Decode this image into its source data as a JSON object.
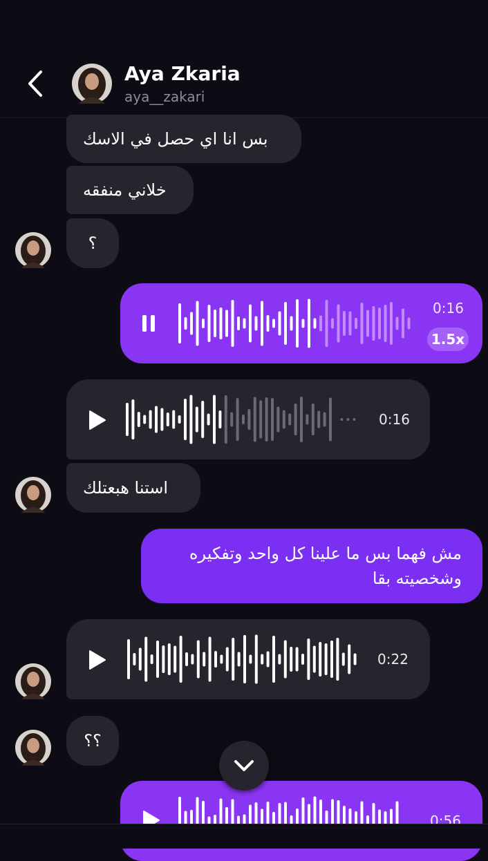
{
  "header": {
    "title": "Aya Zkaria",
    "username": "aya__zakari"
  },
  "messages": {
    "m1": "بس انا اي حصل في الاسك",
    "m2": "خلاني منفقه",
    "m3": "؟",
    "m4_duration": "0:16",
    "m4_speed": "1.5x",
    "m5_duration": "0:16",
    "m6": "استنا هبعتلك",
    "m7_line1": "مش فهما بس ما علينا كل واحد وتفكيره",
    "m7_line2": "وشخصيته بقا",
    "m8_duration": "0:22",
    "m9": "؟؟",
    "m10_duration": "0:56"
  },
  "colors": {
    "background": "#0d0c14",
    "incoming_bubble": "#26252e",
    "outgoing_bubble": "#7b2ff2",
    "outgoing_voice": "#8b35f4"
  },
  "icons": {
    "back": "chevron-left-icon",
    "scroll_down": "chevron-down-icon",
    "play": "play-icon",
    "pause": "pause-icon"
  },
  "playback": {
    "m4_progress": 0.6,
    "m5_progress": 0.47,
    "m8_progress": 0.0
  }
}
